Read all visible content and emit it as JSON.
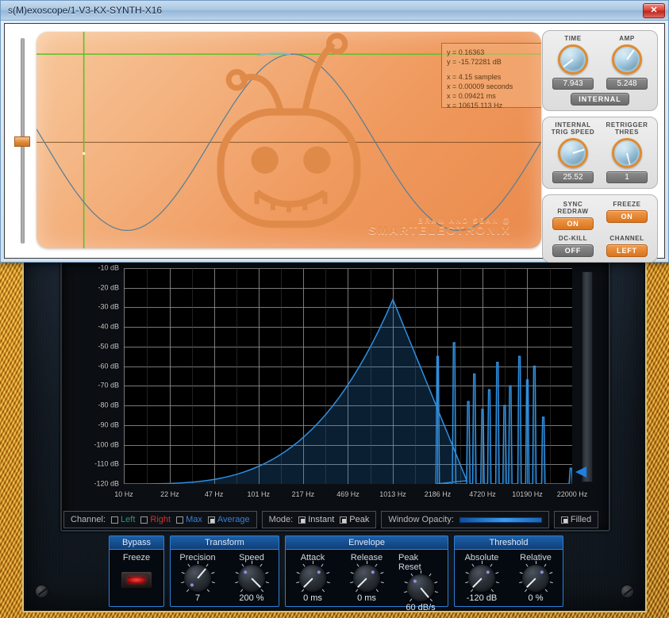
{
  "window": {
    "title": "s(M)exoscope/1-V3-KX-SYNTH-X16",
    "close_label": "✕"
  },
  "scope": {
    "readout": {
      "y_linear": "y = 0.16363",
      "y_db": "y = -15.72281 dB",
      "x_samples": "x = 4.15 samples",
      "x_seconds": "x = 0.00009 seconds",
      "x_ms": "x = 0.09421 ms",
      "x_hz": "x = 10615.113 Hz"
    },
    "brand_line1": "BRAM AND SEAN @",
    "brand_line2": "SMARTELECTRONIX",
    "knobs": [
      {
        "label": "TIME",
        "value": "7.943",
        "angle": -128
      },
      {
        "label": "AMP",
        "value": "5.248",
        "angle": 36
      },
      {
        "label": "INTERNAL\nTRIG SPEED",
        "value": "25.52",
        "angle": 72
      },
      {
        "label": "RETRIGGER\nTHRES",
        "value": "1",
        "angle": 166
      }
    ],
    "mode_button": "INTERNAL",
    "toggles": [
      {
        "label": "SYNC\nREDRAW",
        "value": "ON",
        "state": "on"
      },
      {
        "label": "FREEZE",
        "value": "ON",
        "state": "on"
      },
      {
        "label": "DC-KILL",
        "value": "OFF",
        "state": "off"
      },
      {
        "label": "CHANNEL",
        "value": "LEFT",
        "state": "on"
      }
    ],
    "waveform_color": "#5a7f96",
    "cursor_color": "#5cc02a"
  },
  "chart_data": {
    "type": "line",
    "title": "",
    "xlabel": "",
    "ylabel": "",
    "xscale": "log",
    "grid": true,
    "legend": "none",
    "xlim": [
      10,
      22000
    ],
    "ylim": [
      -120,
      -10
    ],
    "x_ticks": [
      "10 Hz",
      "22 Hz",
      "47 Hz",
      "101 Hz",
      "217 Hz",
      "469 Hz",
      "1013 Hz",
      "2186 Hz",
      "4720 Hz",
      "10190 Hz",
      "22000 Hz"
    ],
    "y_ticks": [
      "-10 dB",
      "-20 dB",
      "-30 dB",
      "-40 dB",
      "-50 dB",
      "-60 dB",
      "-70 dB",
      "-80 dB",
      "-90 dB",
      "-100 dB",
      "-110 dB",
      "-120 dB"
    ],
    "series": [
      {
        "name": "Average",
        "color": "#2f8fe0",
        "filled": true,
        "peaks": [
          {
            "hz": 1013,
            "db": -26
          },
          {
            "hz": 2186,
            "db": -55
          },
          {
            "hz": 2900,
            "db": -48
          },
          {
            "hz": 3700,
            "db": -78
          },
          {
            "hz": 4100,
            "db": -64
          },
          {
            "hz": 4720,
            "db": -82
          },
          {
            "hz": 5300,
            "db": -72
          },
          {
            "hz": 6100,
            "db": -58
          },
          {
            "hz": 6900,
            "db": -80
          },
          {
            "hz": 7600,
            "db": -70
          },
          {
            "hz": 8900,
            "db": -55
          },
          {
            "hz": 10190,
            "db": -67
          },
          {
            "hz": 11500,
            "db": -60
          },
          {
            "hz": 13400,
            "db": -86
          },
          {
            "hz": 21500,
            "db": -112
          }
        ]
      }
    ]
  },
  "options": {
    "channel_label": "Channel:",
    "channel_items": [
      {
        "label": "Left",
        "color": "#2f8f7f",
        "checked": false
      },
      {
        "label": "Right",
        "color": "#cc3333",
        "checked": false
      },
      {
        "label": "Max",
        "color": "#3a7fd5",
        "checked": false
      },
      {
        "label": "Average",
        "color": "#3a7fd5",
        "checked": true
      }
    ],
    "mode_label": "Mode:",
    "mode_items": [
      {
        "label": "Instant",
        "color": "#c4c4c4",
        "checked": true
      },
      {
        "label": "Peak",
        "color": "#c4c4c4",
        "checked": true
      }
    ],
    "opacity_label": "Window Opacity:",
    "filled": {
      "label": "Filled",
      "checked": true
    }
  },
  "controls": [
    {
      "title": "Bypass",
      "kind": "button",
      "items": [
        {
          "label": "Freeze"
        }
      ]
    },
    {
      "title": "Transform",
      "kind": "knobs",
      "items": [
        {
          "label": "Precision",
          "value": "7",
          "angle": 40
        },
        {
          "label": "Speed",
          "value": "200 %",
          "angle": 135
        }
      ]
    },
    {
      "title": "Envelope",
      "kind": "knobs",
      "items": [
        {
          "label": "Attack",
          "value": "0 ms",
          "angle": -135
        },
        {
          "label": "Release",
          "value": "0 ms",
          "angle": -135
        },
        {
          "label": "Peak Reset",
          "value": "60 dB/s",
          "angle": 140
        }
      ]
    },
    {
      "title": "Threshold",
      "kind": "knobs",
      "items": [
        {
          "label": "Absolute",
          "value": "-120 dB",
          "angle": -135
        },
        {
          "label": "Relative",
          "value": "0 %",
          "angle": -135
        }
      ]
    }
  ]
}
